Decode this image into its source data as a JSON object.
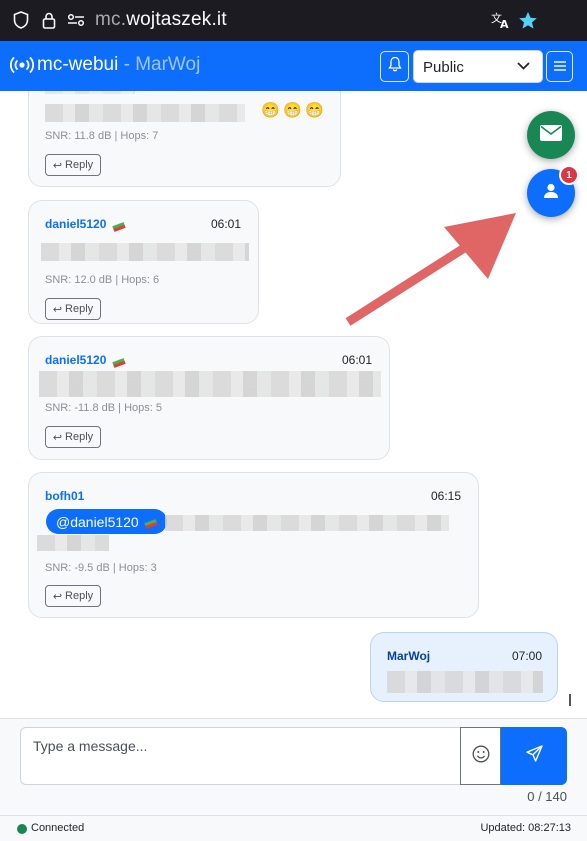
{
  "browser": {
    "url_prefix": "mc.",
    "url_domain": "wojtaszek.it"
  },
  "navbar": {
    "brand": "mc-webui",
    "brand_sub": "- MarWoj",
    "channel_selected": "Public"
  },
  "messages": [
    {
      "sender": "",
      "time": "",
      "emojis": [
        "😁",
        "😁",
        "😁"
      ],
      "meta": "SNR: 11.8 dB | Hops: 7",
      "reply_label": "Reply"
    },
    {
      "sender": "daniel5120",
      "time": "06:01",
      "meta": "SNR: 12.0 dB | Hops: 6",
      "reply_label": "Reply"
    },
    {
      "sender": "daniel5120",
      "time": "06:01",
      "meta": "SNR: -11.8 dB | Hops: 5",
      "reply_label": "Reply"
    },
    {
      "sender": "bofh01",
      "time": "06:15",
      "mention": "@daniel5120",
      "meta": "SNR: -9.5 dB | Hops: 3",
      "reply_label": "Reply"
    },
    {
      "sender": "MarWoj",
      "time": "07:00"
    }
  ],
  "fab": {
    "badge_count": "1"
  },
  "composer": {
    "placeholder": "Type a message...",
    "counter": "0 / 140"
  },
  "status": {
    "connection": "Connected",
    "updated": "Updated: 08:27:13"
  },
  "colors": {
    "primary": "#0d6efd",
    "success": "#198754",
    "danger": "#dc3545",
    "arrow": "#e06666"
  }
}
